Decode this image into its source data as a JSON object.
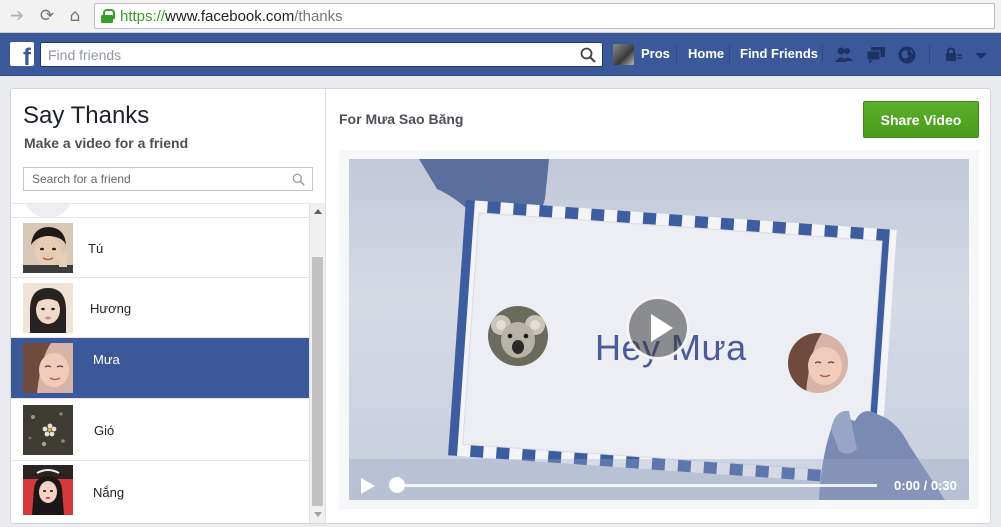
{
  "browser": {
    "url_scheme": "https://",
    "url_domain": "www.facebook.com",
    "url_path": "/thanks",
    "back_icon": "back-arrow-icon",
    "reload_icon": "reload-icon",
    "home_icon": "home-icon",
    "lock_icon": "lock-icon",
    "secure_color": "#3b9d26"
  },
  "header": {
    "brand_color": "#3b5998",
    "search_placeholder": "Find friends",
    "profile_name": "Pros",
    "nav": [
      "Home",
      "Find Friends"
    ],
    "icons": [
      "friend-requests-icon",
      "messages-icon",
      "notifications-globe-icon",
      "privacy-shortcuts-icon",
      "account-menu-icon"
    ]
  },
  "sidebar": {
    "title": "Say Thanks",
    "subtitle": "Make a video for a friend",
    "search_placeholder": "Search for a friend",
    "friends": [
      {
        "name": "Tú",
        "selected": false
      },
      {
        "name": "Hương",
        "selected": false
      },
      {
        "name": "Mưa",
        "selected": true
      },
      {
        "name": "Gió",
        "selected": false
      },
      {
        "name": "Nắng",
        "selected": false
      }
    ]
  },
  "video": {
    "title": "For Mưa Sao Băng",
    "share_label": "Share Video",
    "share_color": "#4a9c1d",
    "greeting": "Hey Mưa",
    "time_label": "0:00 / 0:30",
    "progress": 0
  }
}
